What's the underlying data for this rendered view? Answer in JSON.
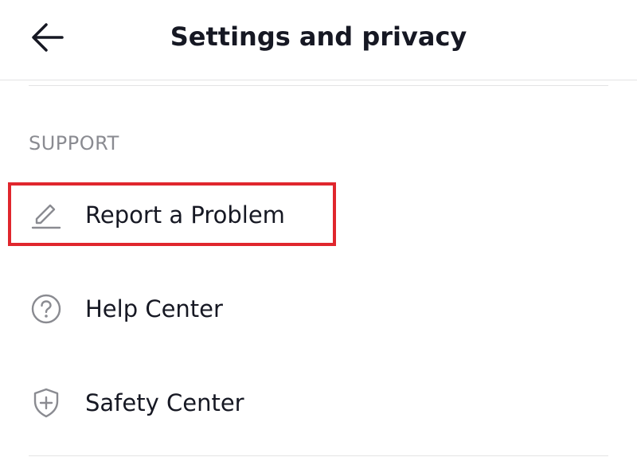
{
  "header": {
    "title": "Settings and privacy",
    "back_icon": "arrow-left-icon"
  },
  "section": {
    "title": "SUPPORT",
    "items": [
      {
        "label": "Report a Problem",
        "icon": "pencil-icon",
        "highlighted": true
      },
      {
        "label": "Help Center",
        "icon": "question-circle-icon"
      },
      {
        "label": "Safety Center",
        "icon": "shield-plus-icon"
      }
    ]
  },
  "colors": {
    "text": "#161823",
    "muted": "#8a8b91",
    "divider": "#e3e3e4",
    "highlight": "#e0262d",
    "icon": "#8a8b91"
  }
}
